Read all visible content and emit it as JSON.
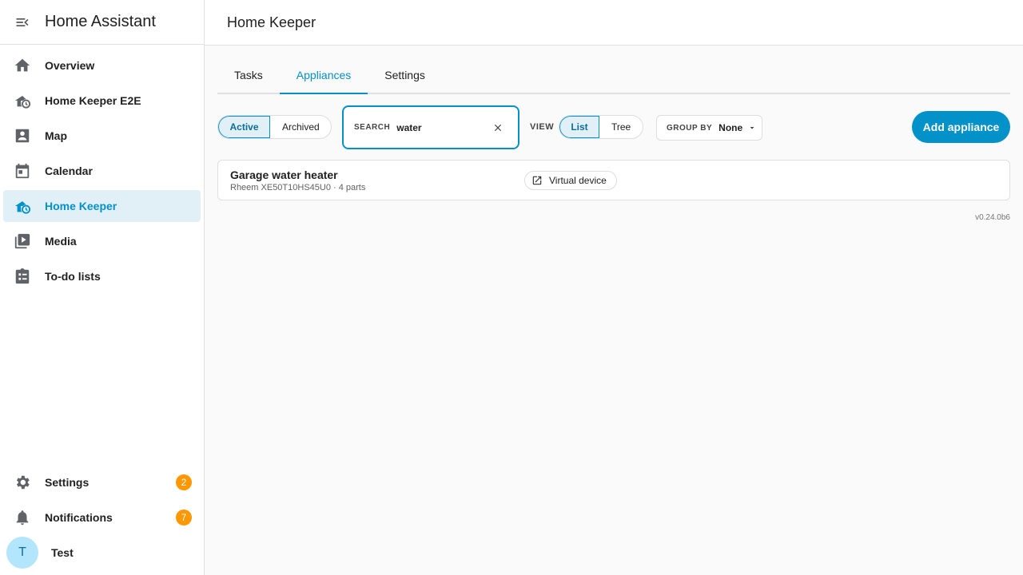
{
  "sidebar": {
    "title": "Home Assistant",
    "items": [
      {
        "label": "Overview",
        "icon": "home-icon"
      },
      {
        "label": "Home Keeper E2E",
        "icon": "home-clock-icon"
      },
      {
        "label": "Map",
        "icon": "map-icon"
      },
      {
        "label": "Calendar",
        "icon": "calendar-icon"
      },
      {
        "label": "Home Keeper",
        "icon": "home-clock-icon",
        "active": true
      },
      {
        "label": "Media",
        "icon": "media-icon"
      },
      {
        "label": "To-do lists",
        "icon": "todo-icon"
      }
    ],
    "settings": {
      "label": "Settings",
      "badge": "2"
    },
    "notifications": {
      "label": "Notifications",
      "badge": "7"
    },
    "user": {
      "initial": "T",
      "name": "Test"
    }
  },
  "header": {
    "title": "Home Keeper"
  },
  "tabs": [
    {
      "label": "Tasks"
    },
    {
      "label": "Appliances",
      "active": true
    },
    {
      "label": "Settings"
    }
  ],
  "toolbar": {
    "status_filter": {
      "active": "Active",
      "archived": "Archived"
    },
    "search": {
      "label": "SEARCH",
      "value": "water"
    },
    "view": {
      "label": "VIEW",
      "list": "List",
      "tree": "Tree"
    },
    "group_by": {
      "label": "GROUP BY",
      "value": "None"
    },
    "add_button": "Add appliance"
  },
  "appliances": [
    {
      "name": "Garage water heater",
      "subtitle": "Rheem XE50T10HS45U0 · 4 parts",
      "device": "Virtual device"
    }
  ],
  "version": "v0.24.0b6",
  "colors": {
    "accent": "#0391c9",
    "badge": "#ff9800",
    "active_bg": "#e1f0f7"
  }
}
